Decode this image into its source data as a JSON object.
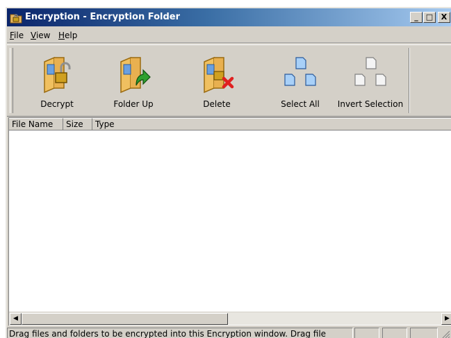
{
  "window": {
    "title": "Encryption - Encryption Folder",
    "controls": {
      "minimize": "_",
      "maximize": "□",
      "close": "X"
    }
  },
  "menu": {
    "items": [
      {
        "accel": "F",
        "rest": "ile"
      },
      {
        "accel": "V",
        "rest": "iew"
      },
      {
        "accel": "H",
        "rest": "elp"
      }
    ]
  },
  "toolbar": {
    "buttons": [
      {
        "label": "Decrypt",
        "icon": "decrypt-folder-icon"
      },
      {
        "label": "Folder Up",
        "icon": "folder-up-icon"
      },
      {
        "label": "Delete",
        "icon": "delete-folder-icon"
      },
      {
        "label": "Select All",
        "icon": "select-all-icon"
      },
      {
        "label": "Invert Selection",
        "icon": "invert-selection-icon"
      }
    ]
  },
  "list": {
    "columns": [
      "File Name",
      "Size",
      "Type"
    ],
    "rows": []
  },
  "statusbar": {
    "text": "Drag files and folders to be encrypted into this Encryption window. Drag file"
  },
  "colors": {
    "titlebar_start": "#0a246a",
    "titlebar_end": "#a6caf0",
    "chrome": "#d4d0c8",
    "delete_red": "#e02020",
    "arrow_green": "#2fa02f"
  }
}
